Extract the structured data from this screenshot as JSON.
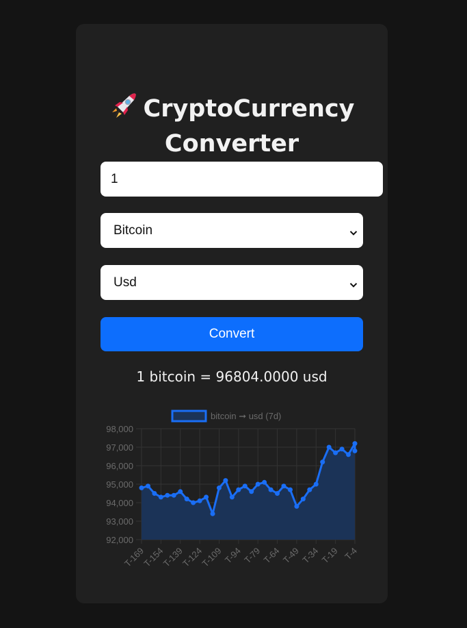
{
  "title": {
    "icon": "rocket-icon",
    "line1": "CryptoCurrency",
    "line2": "Converter"
  },
  "amount": {
    "value": "1"
  },
  "from_currency": {
    "selected": "Bitcoin"
  },
  "to_currency": {
    "selected": "Usd"
  },
  "convert_label": "Convert",
  "result_text": "1 bitcoin = 96804.0000 usd",
  "colors": {
    "accent": "#0d6efd",
    "line": "#1a6ef5",
    "fill": "#1b3357",
    "card": "#202020",
    "background": "#141414"
  },
  "chart_data": {
    "type": "area",
    "legend": "bitcoin ➞ usd (7d)",
    "legend_position": "top-center",
    "x_ticks": [
      "T-169",
      "T-154",
      "T-139",
      "T-124",
      "T-109",
      "T-94",
      "T-79",
      "T-64",
      "T-49",
      "T-34",
      "T-19",
      "T-4"
    ],
    "y_ticks": [
      "98,000",
      "97,000",
      "96,000",
      "95,000",
      "94,000",
      "93,000",
      "92,000"
    ],
    "ylim": [
      92000,
      98000
    ],
    "grid": true,
    "x": [
      -169,
      -164,
      -159,
      -154,
      -149,
      -144,
      -139,
      -134,
      -129,
      -124,
      -119,
      -114,
      -109,
      -104,
      -99,
      -94,
      -89,
      -84,
      -79,
      -74,
      -69,
      -64,
      -59,
      -54,
      -49,
      -44,
      -39,
      -34,
      -29,
      -24,
      -19,
      -14,
      -9,
      -4,
      -1
    ],
    "values": [
      94800,
      94900,
      94500,
      94300,
      94400,
      94400,
      94600,
      94200,
      94000,
      94100,
      94300,
      93400,
      94800,
      95200,
      94300,
      94700,
      94900,
      94600,
      95000,
      95100,
      94700,
      94500,
      94900,
      94700,
      93800,
      94200,
      94700,
      95000,
      96200,
      97000,
      96700,
      96900,
      96600,
      97200,
      96800
    ]
  }
}
